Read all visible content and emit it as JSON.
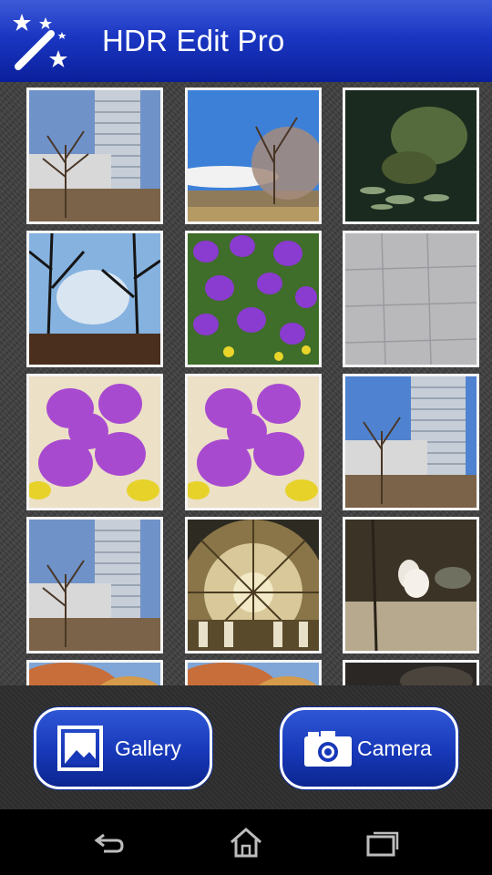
{
  "app_bar": {
    "title": "HDR Edit Pro",
    "icon": "magic-wand-stars-icon"
  },
  "photos": [
    {
      "subject": "office-tower-trees"
    },
    {
      "subject": "tree-blue-sky"
    },
    {
      "subject": "turtle-aquarium"
    },
    {
      "subject": "tree-silhouette"
    },
    {
      "subject": "purple-flower-bed"
    },
    {
      "subject": "paving-tiles"
    },
    {
      "subject": "purple-flowers-closeup"
    },
    {
      "subject": "purple-flowers-closeup"
    },
    {
      "subject": "office-tower-trees"
    },
    {
      "subject": "office-tower-trees"
    },
    {
      "subject": "station-dome-ceiling"
    },
    {
      "subject": "pelicans"
    },
    {
      "subject": "autumn-tree"
    },
    {
      "subject": "autumn-tree"
    },
    {
      "subject": "dark-scene"
    }
  ],
  "actions": {
    "gallery_label": "Gallery",
    "camera_label": "Camera"
  },
  "colors": {
    "appbar": "#1a36c2",
    "button": "#1738b8",
    "background": "#3e3e3e"
  },
  "nav": {
    "back_icon": "back-icon",
    "home_icon": "home-icon",
    "recents_icon": "recent-apps-icon"
  }
}
